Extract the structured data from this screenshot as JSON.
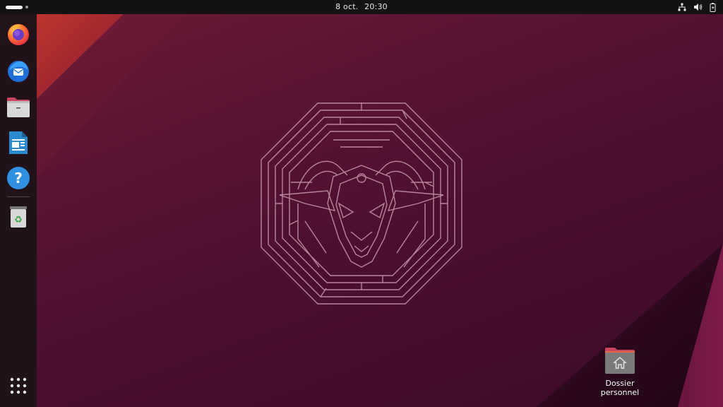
{
  "topbar": {
    "date": "8 oct.",
    "time": "20:30",
    "tray_icons": [
      "network-wired-icon",
      "volume-icon",
      "battery-icon"
    ]
  },
  "dock": {
    "apps": [
      {
        "name": "Firefox",
        "icon": "firefox-icon"
      },
      {
        "name": "Thunderbird",
        "icon": "thunderbird-icon"
      },
      {
        "name": "Fichiers",
        "icon": "files-icon"
      },
      {
        "name": "LibreOffice Writer",
        "icon": "libreoffice-writer-icon"
      },
      {
        "name": "Aide",
        "icon": "help-icon"
      },
      {
        "name": "Corbeille",
        "icon": "trash-icon"
      }
    ],
    "app_grid_icon": "app-grid-icon"
  },
  "desktop": {
    "home_folder": {
      "label_line1": "Dossier",
      "label_line2": "personnel",
      "icon": "home-folder-icon"
    }
  },
  "colors": {
    "wallpaper_base": "#4a0e30",
    "wallpaper_accent": "#b8322e",
    "topbar": "#131313",
    "dock": "#1c1218",
    "maze_lines": "#c99aaf"
  }
}
